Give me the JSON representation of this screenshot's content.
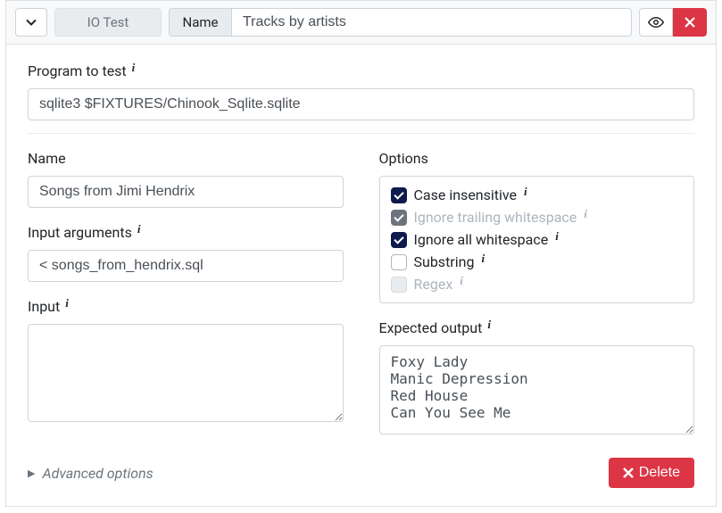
{
  "header": {
    "type_label": "IO Test",
    "name_field_label": "Name",
    "name_value": "Tracks by artists"
  },
  "program": {
    "label": "Program to test",
    "value": "sqlite3 $FIXTURES/Chinook_Sqlite.sqlite"
  },
  "left": {
    "name_label": "Name",
    "name_value": "Songs from Jimi Hendrix",
    "input_args_label": "Input arguments",
    "input_args_value": "< songs_from_hendrix.sql",
    "input_label": "Input",
    "input_value": ""
  },
  "right": {
    "options_label": "Options",
    "options": {
      "case_insensitive": "Case insensitive",
      "ignore_trailing_ws": "Ignore trailing whitespace",
      "ignore_all_ws": "Ignore all whitespace",
      "substring": "Substring",
      "regex": "Regex"
    },
    "expected_label": "Expected output",
    "expected_value": "Foxy Lady\nManic Depression\nRed House\nCan You See Me"
  },
  "footer": {
    "advanced_label": "Advanced options",
    "delete_label": "Delete"
  }
}
